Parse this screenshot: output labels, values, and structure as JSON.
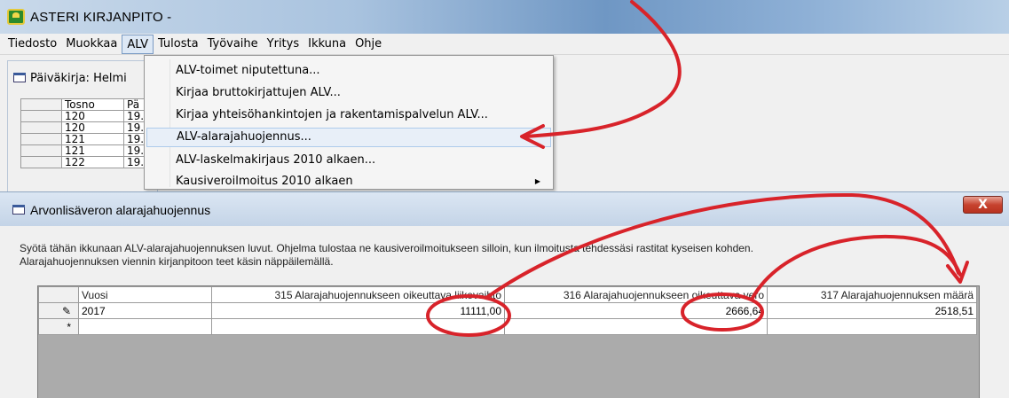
{
  "app": {
    "title": "ASTERI KIRJANPITO -"
  },
  "menubar": {
    "items": [
      "Tiedosto",
      "Muokkaa",
      "ALV",
      "Tulosta",
      "Työvaihe",
      "Yritys",
      "Ikkuna",
      "Ohje"
    ],
    "active": "ALV"
  },
  "journal_window": {
    "title": "Päiväkirja: Helmi",
    "columns": [
      "Tosno",
      "Pä"
    ],
    "rows": [
      {
        "tosno": "120",
        "pvm": "19."
      },
      {
        "tosno": "120",
        "pvm": "19."
      },
      {
        "tosno": "121",
        "pvm": "19."
      },
      {
        "tosno": "121",
        "pvm": "19."
      },
      {
        "tosno": "122",
        "pvm": "19."
      }
    ]
  },
  "alv_menu": {
    "items": [
      {
        "label": "ALV-toimet niputettuna..."
      },
      {
        "label": "Kirjaa bruttokirjattujen ALV..."
      },
      {
        "label": "Kirjaa yhteisöhankintojen ja rakentamispalvelun ALV..."
      },
      {
        "label": "ALV-alarajahuojennus...",
        "highlighted": true
      },
      {
        "label": "ALV-laskelmakirjaus 2010 alkaen..."
      },
      {
        "label": "Kausiveroilmoitus 2010 alkaen",
        "submenu": true
      }
    ]
  },
  "dialog": {
    "title": "Arvonlisäveron alarajahuojennus",
    "close_label": "X",
    "instructions_line1": "Syötä tähän ikkunaan ALV-alarajahuojennuksen luvut. Ohjelma tulostaa ne kausiveroilmoitukseen silloin, kun ilmoitusta tehdessäsi rastitat kyseisen kohden.",
    "instructions_line2": "Alarajahuojennuksen viennin kirjanpitoon teet käsin näppäilemällä.",
    "grid": {
      "columns": [
        "Vuosi",
        "315 Alarajahuojennukseen oikeuttava liikevaihto",
        "316 Alarajahuojennukseen oikeuttava vero",
        "317 Alarajahuojennuksen määrä"
      ],
      "rows": [
        {
          "marker": "✎",
          "vuosi": "2017",
          "liikevaihto": "11111,00",
          "vero": "2666,64",
          "maara": "2518,51"
        },
        {
          "marker": "*",
          "vuosi": "",
          "liikevaihto": "",
          "vero": "",
          "maara": ""
        }
      ]
    }
  },
  "colors": {
    "annotation": "#d8232a",
    "menu_highlight": "#e8eff8",
    "close_button": "#c7432f"
  }
}
